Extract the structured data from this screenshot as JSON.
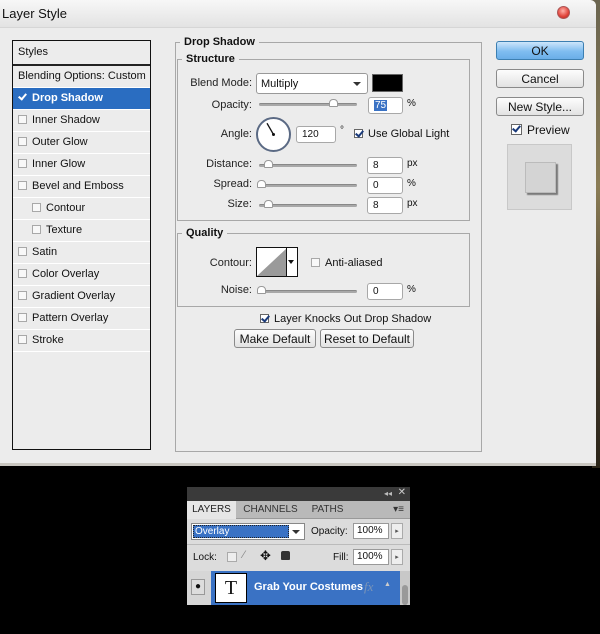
{
  "dialog": {
    "title": "Layer Style",
    "close_icon": "close-icon"
  },
  "styles_list": {
    "header": "Styles",
    "blending": "Blending Options: Custom",
    "items": [
      {
        "label": "Drop Shadow",
        "checked": true,
        "selected": true,
        "indent": false
      },
      {
        "label": "Inner Shadow",
        "checked": false,
        "selected": false,
        "indent": false
      },
      {
        "label": "Outer Glow",
        "checked": false,
        "selected": false,
        "indent": false
      },
      {
        "label": "Inner Glow",
        "checked": false,
        "selected": false,
        "indent": false
      },
      {
        "label": "Bevel and Emboss",
        "checked": false,
        "selected": false,
        "indent": false
      },
      {
        "label": "Contour",
        "checked": false,
        "selected": false,
        "indent": true
      },
      {
        "label": "Texture",
        "checked": false,
        "selected": false,
        "indent": true
      },
      {
        "label": "Satin",
        "checked": false,
        "selected": false,
        "indent": false
      },
      {
        "label": "Color Overlay",
        "checked": false,
        "selected": false,
        "indent": false
      },
      {
        "label": "Gradient Overlay",
        "checked": false,
        "selected": false,
        "indent": false
      },
      {
        "label": "Pattern Overlay",
        "checked": false,
        "selected": false,
        "indent": false
      },
      {
        "label": "Stroke",
        "checked": false,
        "selected": false,
        "indent": false
      }
    ]
  },
  "drop_shadow": {
    "section_title": "Drop Shadow",
    "structure": {
      "title": "Structure",
      "blend_mode_label": "Blend Mode:",
      "blend_mode_value": "Multiply",
      "shadow_color": "#000000",
      "opacity_label": "Opacity:",
      "opacity_value": "75",
      "opacity_fraction": 0.75,
      "percent_unit": "%",
      "angle_label": "Angle:",
      "angle_value": "120",
      "degree_unit": "°",
      "use_global_light_label": "Use Global Light",
      "use_global_light_checked": true,
      "distance_label": "Distance:",
      "distance_value": "8",
      "px_unit": "px",
      "spread_label": "Spread:",
      "spread_value": "0",
      "size_label": "Size:",
      "size_value": "8"
    },
    "quality": {
      "title": "Quality",
      "contour_label": "Contour:",
      "anti_aliased_label": "Anti-aliased",
      "anti_aliased_checked": false,
      "noise_label": "Noise:",
      "noise_value": "0"
    },
    "knockout_label": "Layer Knocks Out Drop Shadow",
    "knockout_checked": true,
    "make_default": "Make Default",
    "reset_default": "Reset to Default"
  },
  "buttons": {
    "ok": "OK",
    "cancel": "Cancel",
    "new_style": "New Style...",
    "preview_label": "Preview",
    "preview_checked": true
  },
  "layers_panel": {
    "tabs": [
      "LAYERS",
      "CHANNELS",
      "PATHS"
    ],
    "active_tab": "LAYERS",
    "blend_mode": "Overlay",
    "opacity_label": "Opacity:",
    "opacity_value": "100%",
    "lock_label": "Lock:",
    "fill_label": "Fill:",
    "fill_value": "100%",
    "layer": {
      "thumbnail_glyph": "T",
      "name": "Grab Your Costumes",
      "fx_label": "fx"
    }
  }
}
